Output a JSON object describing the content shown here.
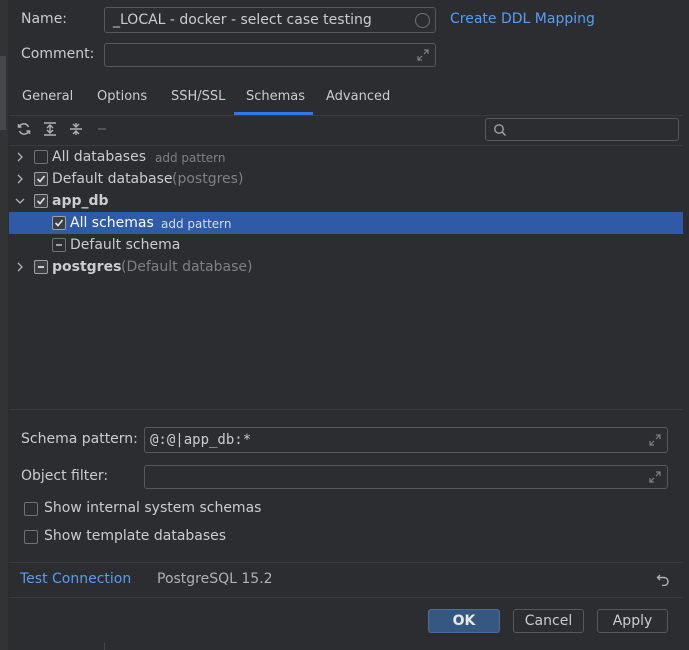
{
  "form": {
    "name_label": "Name:",
    "name_value": "_LOCAL - docker - select case testing",
    "create_ddl_link": "Create DDL Mapping",
    "comment_label": "Comment:",
    "comment_value": ""
  },
  "tabs": [
    {
      "label": "General"
    },
    {
      "label": "Options"
    },
    {
      "label": "SSH/SSL"
    },
    {
      "label": "Schemas",
      "active": true
    },
    {
      "label": "Advanced"
    }
  ],
  "toolbar": {
    "icons": [
      "refresh-icon",
      "expand-all-icon",
      "collapse-all-icon",
      "remove-icon"
    ],
    "search_placeholder": ""
  },
  "tree": [
    {
      "label": "All databases",
      "extra": "add pattern",
      "checked": false,
      "expanded": false
    },
    {
      "label": "Default database",
      "extra": "(postgres)",
      "checked": true,
      "expanded": false
    },
    {
      "label": "app_db",
      "extra": "",
      "checked": true,
      "expanded": true,
      "bold": true
    },
    {
      "label": "All schemas",
      "extra": "add pattern",
      "checked": true,
      "selected": true
    },
    {
      "label": "Default schema",
      "extra": "",
      "checked": "partial"
    },
    {
      "label": "postgres",
      "extra": "(Default database)",
      "checked": "partial",
      "expanded": false,
      "bold": true
    }
  ],
  "filters": {
    "schema_pattern_label": "Schema pattern:",
    "schema_pattern_value": "@:@|app_db:*",
    "object_filter_label": "Object filter:",
    "object_filter_value": "",
    "show_internal_label": "Show internal system schemas",
    "show_template_label": "Show template databases"
  },
  "status": {
    "test_connection": "Test Connection",
    "version": "PostgreSQL 15.2"
  },
  "buttons": {
    "ok": "OK",
    "cancel": "Cancel",
    "apply": "Apply"
  },
  "colors": {
    "accent": "#589df6",
    "selection": "#2e5aa8",
    "primary_button": "#365880"
  }
}
